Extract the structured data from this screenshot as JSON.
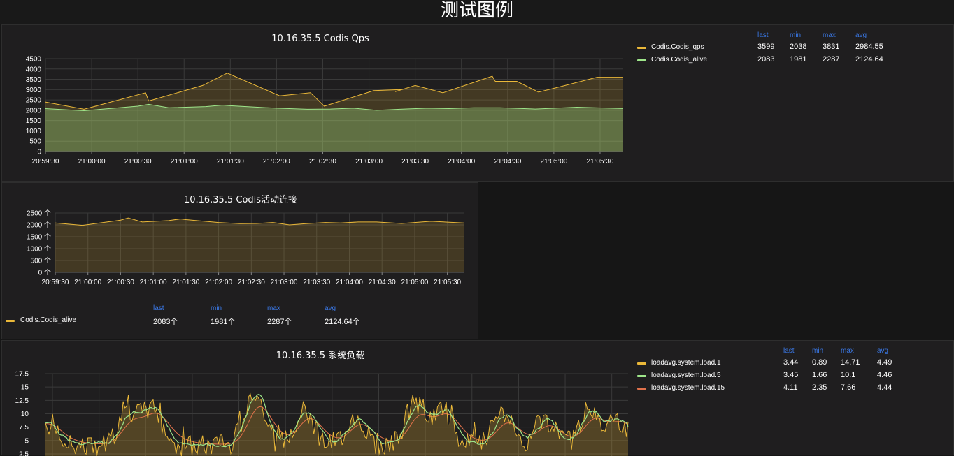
{
  "page": {
    "title": "测试图例"
  },
  "panels": [
    {
      "title": "10.16.35.5 Codis Qps",
      "legend_headers": [
        "last",
        "min",
        "max",
        "avg"
      ],
      "legend": [
        {
          "name": "Codis.Codis_qps",
          "color": "#eab839",
          "last": "3599",
          "min": "2038",
          "max": "3831",
          "avg": "2984.55"
        },
        {
          "name": "Codis.Codis_alive",
          "color": "#9ee58a",
          "last": "2083",
          "min": "1981",
          "max": "2287",
          "avg": "2124.64"
        }
      ]
    },
    {
      "title": "10.16.35.5 Codis活动连接",
      "legend_headers": [
        "last",
        "min",
        "max",
        "avg"
      ],
      "legend": [
        {
          "name": "Codis.Codis_alive",
          "color": "#eab839",
          "last": "2083个",
          "min": "1981个",
          "max": "2287个",
          "avg": "2124.64个"
        }
      ]
    },
    {
      "title": "10.16.35.5 系统负载",
      "legend_headers": [
        "last",
        "min",
        "max",
        "avg"
      ],
      "legend": [
        {
          "name": "loadavg.system.load.1",
          "color": "#eab839",
          "last": "3.44",
          "min": "0.89",
          "max": "14.71",
          "avg": "4.49"
        },
        {
          "name": "loadavg.system.load.5",
          "color": "#9ee58a",
          "last": "3.45",
          "min": "1.66",
          "max": "10.1",
          "avg": "4.46"
        },
        {
          "name": "loadavg.system.load.15",
          "color": "#e0714b",
          "last": "4.11",
          "min": "2.35",
          "max": "7.66",
          "avg": "4.44"
        }
      ]
    }
  ],
  "chart_data": [
    {
      "type": "area",
      "title": "10.16.35.5 Codis Qps",
      "x_ticks": [
        "20:59:30",
        "21:00:00",
        "21:00:30",
        "21:01:00",
        "21:01:30",
        "21:02:00",
        "21:02:30",
        "21:03:00",
        "21:03:30",
        "21:04:00",
        "21:04:30",
        "21:05:00",
        "21:05:30"
      ],
      "y_ticks": [
        "0",
        "500",
        "1000",
        "1500",
        "2000",
        "2500",
        "3000",
        "3500",
        "4000",
        "4500"
      ],
      "ylim": [
        0,
        4500
      ],
      "xlim_seconds_from_first_tick": [
        0,
        375
      ],
      "series": [
        {
          "name": "Codis.Codis_qps",
          "color": "#eab839",
          "x": [
            0,
            25,
            65,
            67,
            102,
            118,
            152,
            172,
            181,
            213,
            231,
            227,
            240,
            258,
            290,
            292,
            306,
            320,
            332,
            358
          ],
          "y": [
            2400,
            2050,
            2850,
            2450,
            3200,
            3800,
            2700,
            2850,
            2200,
            2950,
            3000,
            2900,
            3200,
            2850,
            3650,
            3400,
            3400,
            2880,
            3100,
            3599
          ]
        },
        {
          "name": "Codis.Codis_alive",
          "color": "#9ee58a",
          "x": [
            0,
            25,
            60,
            67,
            80,
            104,
            115,
            120,
            150,
            170,
            185,
            200,
            215,
            230,
            248,
            262,
            278,
            295,
            318,
            345,
            375
          ],
          "y": [
            2080,
            1981,
            2200,
            2287,
            2120,
            2180,
            2250,
            2220,
            2100,
            2050,
            2060,
            2100,
            2000,
            2050,
            2100,
            2080,
            2120,
            2120,
            2060,
            2150,
            2083
          ]
        }
      ],
      "grid": true
    },
    {
      "type": "area",
      "title": "10.16.35.5 Codis活动连接",
      "x_ticks": [
        "20:59:30",
        "21:00:00",
        "21:00:30",
        "21:01:00",
        "21:01:30",
        "21:02:00",
        "21:02:30",
        "21:03:00",
        "21:03:30",
        "21:04:00",
        "21:04:30",
        "21:05:00",
        "21:05:30"
      ],
      "y_ticks": [
        "0 个",
        "500 个",
        "1000 个",
        "1500 个",
        "2000 个",
        "2500 个"
      ],
      "ylim": [
        0,
        2500
      ],
      "series": [
        {
          "name": "Codis.Codis_alive",
          "color": "#eab839",
          "x": [
            0,
            25,
            60,
            67,
            80,
            104,
            115,
            120,
            150,
            170,
            185,
            200,
            215,
            230,
            248,
            262,
            278,
            295,
            318,
            345,
            375
          ],
          "y": [
            2080,
            1981,
            2200,
            2287,
            2120,
            2180,
            2250,
            2220,
            2100,
            2050,
            2060,
            2100,
            2000,
            2050,
            2100,
            2080,
            2120,
            2120,
            2060,
            2150,
            2083
          ]
        }
      ],
      "grid": true
    },
    {
      "type": "area",
      "title": "10.16.35.5 系统负载",
      "y_ticks": [
        "2.5",
        "5",
        "7.5",
        "10",
        "12.5",
        "15",
        "17.5"
      ],
      "ylim": [
        0,
        17.5
      ],
      "series": [
        {
          "name": "loadavg.system.load.1",
          "color": "#eab839"
        },
        {
          "name": "loadavg.system.load.5",
          "color": "#9ee58a"
        },
        {
          "name": "loadavg.system.load.15",
          "color": "#e0714b"
        }
      ],
      "grid": true
    }
  ]
}
